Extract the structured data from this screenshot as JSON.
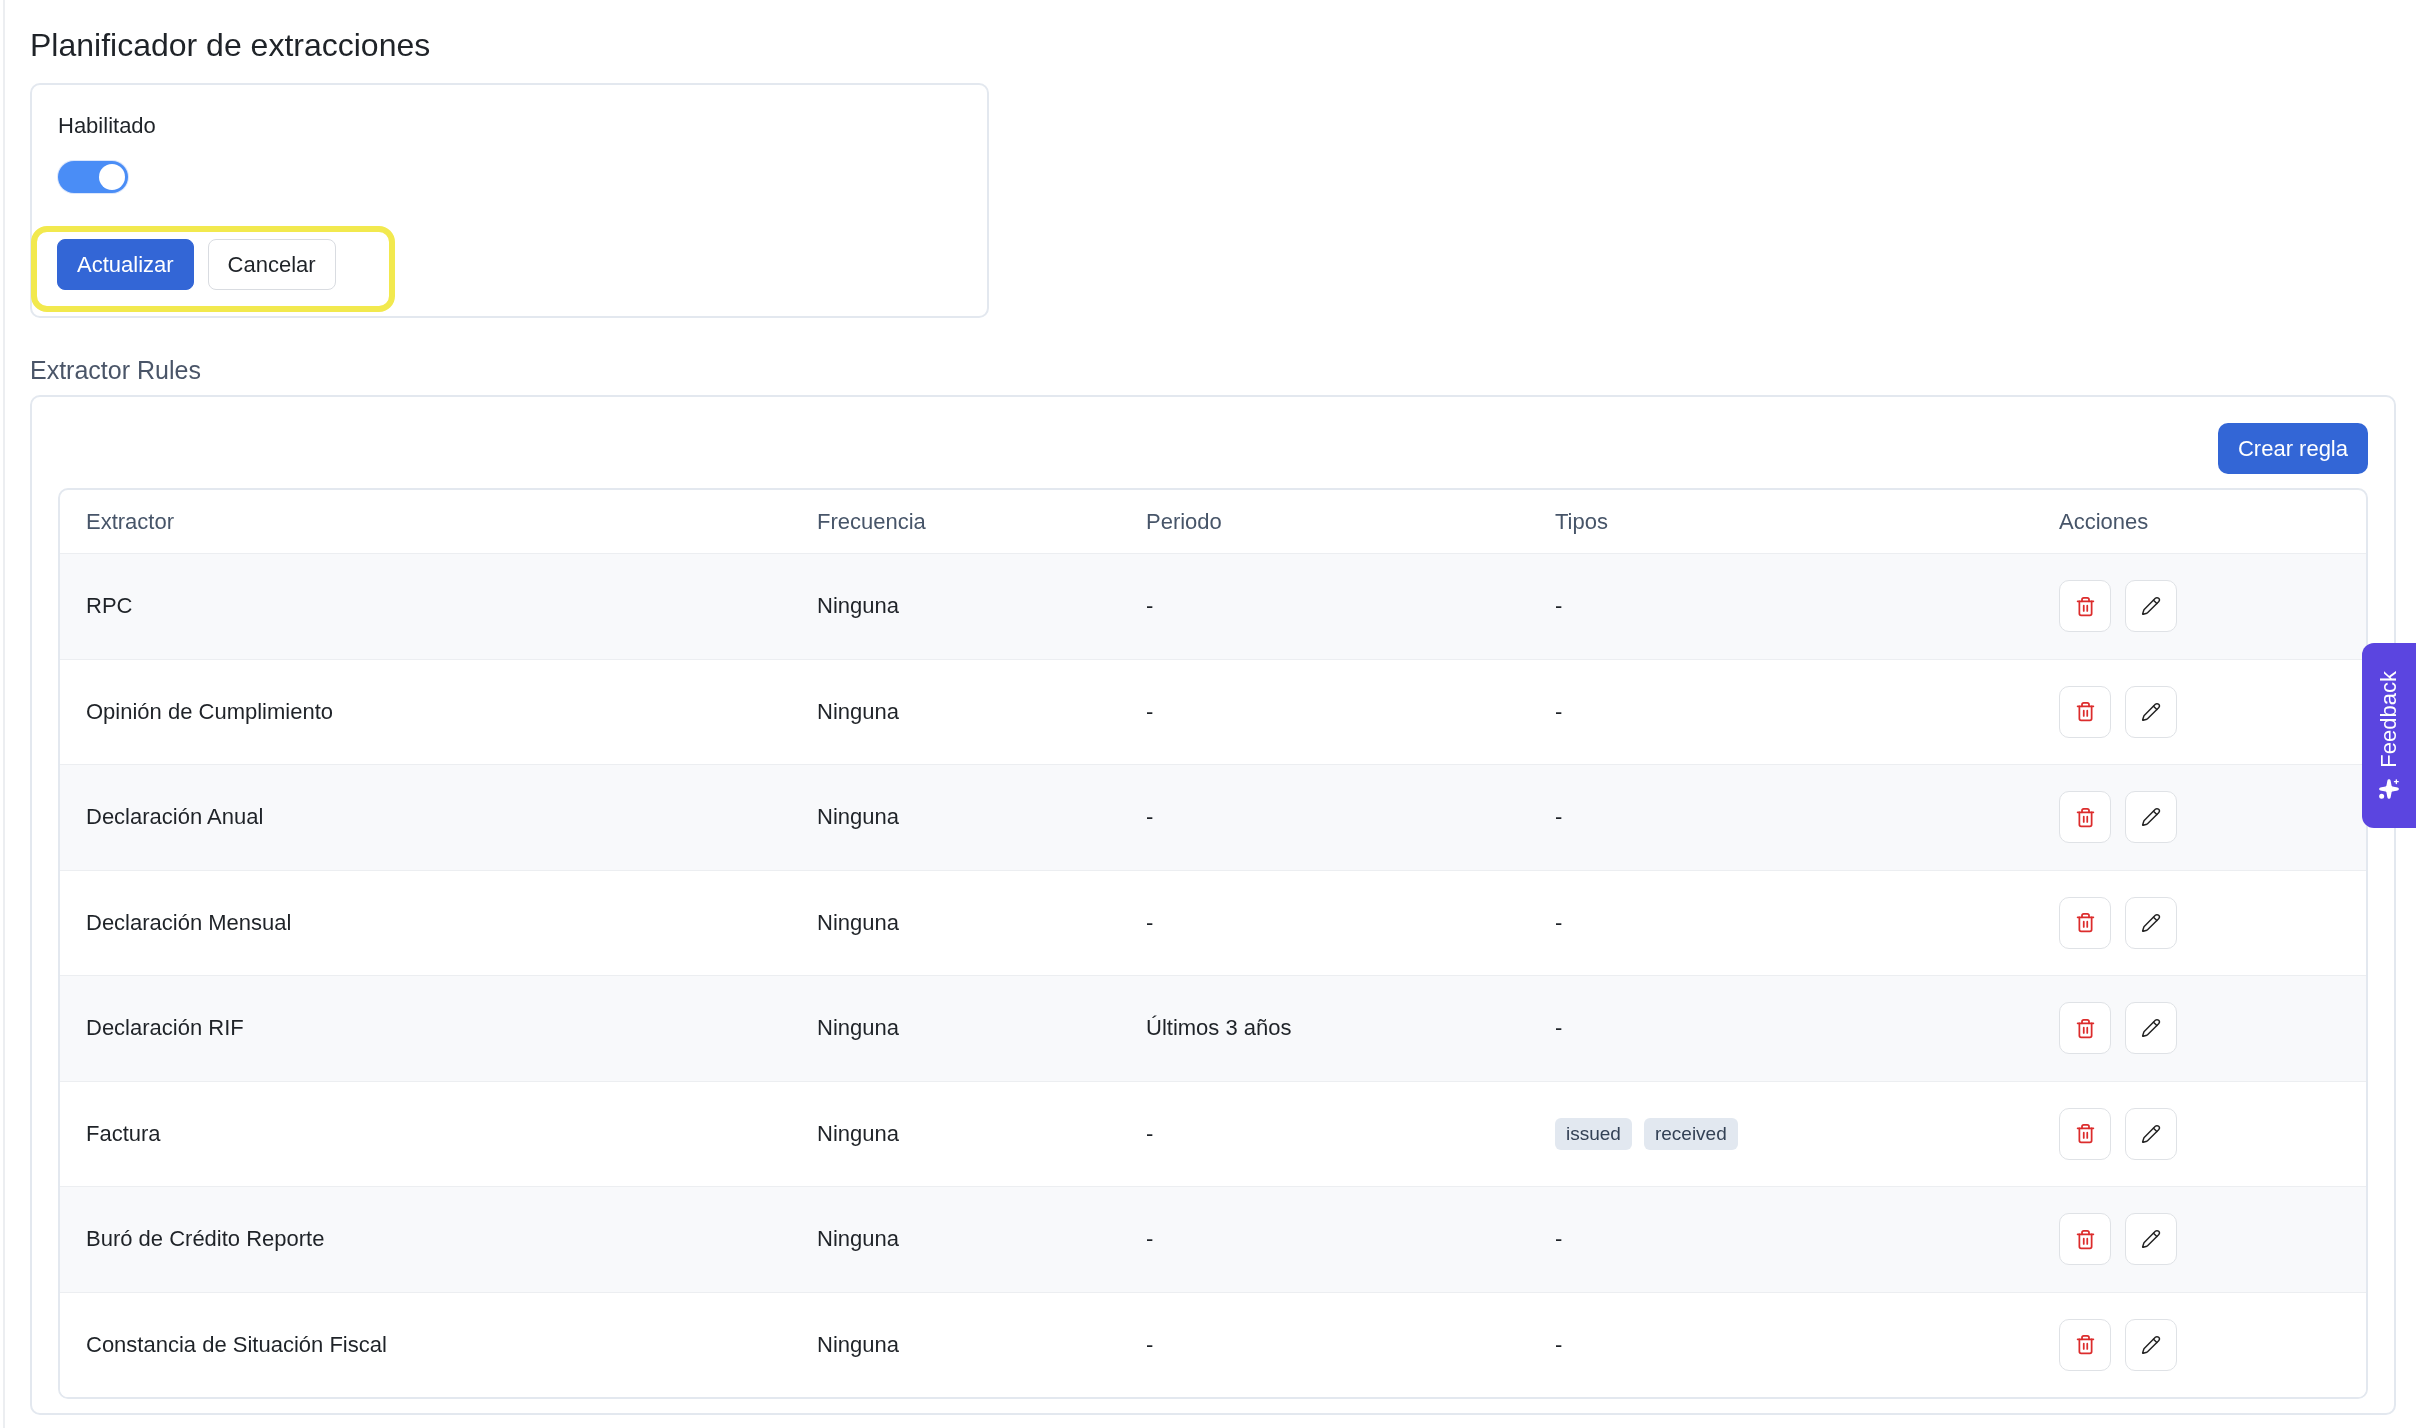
{
  "page": {
    "title": "Planificador de extracciones"
  },
  "scheduler": {
    "enabled": {
      "label": "Habilitado",
      "on": true
    },
    "actions": {
      "highlighted": true,
      "buttons": [
        {
          "label": "Actualizar",
          "kind": "primary"
        },
        {
          "label": "Cancelar",
          "kind": "secondary"
        }
      ]
    }
  },
  "rules": {
    "title": "Extractor Rules",
    "create_button": {
      "label": "Crear regla"
    },
    "table": {
      "columns": [
        "Extractor",
        "Frecuencia",
        "Periodo",
        "Tipos",
        "Acciones"
      ],
      "rows": [
        {
          "extractor": "RPC",
          "frecuencia": "Ninguna",
          "periodo": "-",
          "tipos": "-"
        },
        {
          "extractor": "Opinión de Cumplimiento",
          "frecuencia": "Ninguna",
          "periodo": "-",
          "tipos": "-"
        },
        {
          "extractor": "Declaración Anual",
          "frecuencia": "Ninguna",
          "periodo": "-",
          "tipos": "-"
        },
        {
          "extractor": "Declaración Mensual",
          "frecuencia": "Ninguna",
          "periodo": "-",
          "tipos": "-"
        },
        {
          "extractor": "Declaración RIF",
          "frecuencia": "Ninguna",
          "periodo": "Últimos 3 años",
          "tipos": "-"
        },
        {
          "extractor": "Factura",
          "frecuencia": "Ninguna",
          "periodo": "-",
          "tipos": [
            "issued",
            "received"
          ]
        },
        {
          "extractor": "Buró de Crédito Reporte",
          "frecuencia": "Ninguna",
          "periodo": "-",
          "tipos": "-"
        },
        {
          "extractor": "Constancia de Situación Fiscal",
          "frecuencia": "Ninguna",
          "periodo": "-",
          "tipos": "-"
        }
      ]
    }
  },
  "feedback_tab": {
    "label": "Feedback"
  }
}
